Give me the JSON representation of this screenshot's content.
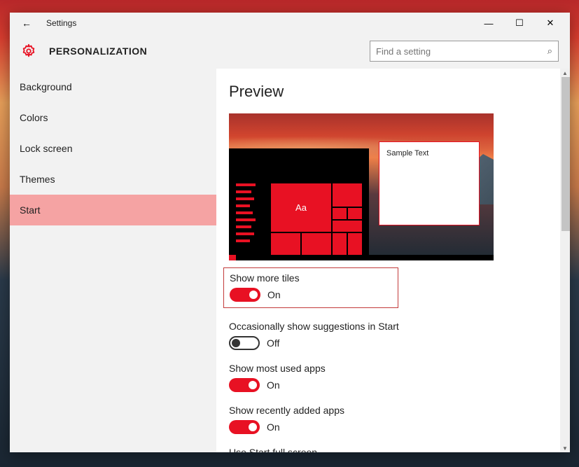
{
  "window": {
    "title": "Settings",
    "back_glyph": "←",
    "min_glyph": "—",
    "max_glyph": "☐",
    "close_glyph": "✕"
  },
  "header": {
    "page_title": "PERSONALIZATION",
    "search_placeholder": "Find a setting"
  },
  "sidebar": {
    "items": [
      {
        "label": "Background",
        "selected": false
      },
      {
        "label": "Colors",
        "selected": false
      },
      {
        "label": "Lock screen",
        "selected": false
      },
      {
        "label": "Themes",
        "selected": false
      },
      {
        "label": "Start",
        "selected": true
      }
    ]
  },
  "content": {
    "heading": "Preview",
    "preview": {
      "tile_text": "Aa",
      "sample_text": "Sample Text"
    },
    "settings": [
      {
        "label": "Show more tiles",
        "state": "On",
        "on": true,
        "highlighted": true
      },
      {
        "label": "Occasionally show suggestions in Start",
        "state": "Off",
        "on": false,
        "highlighted": false
      },
      {
        "label": "Show most used apps",
        "state": "On",
        "on": true,
        "highlighted": false
      },
      {
        "label": "Show recently added apps",
        "state": "On",
        "on": true,
        "highlighted": false
      },
      {
        "label": "Use Start full screen",
        "state": "",
        "on": null,
        "highlighted": false
      }
    ]
  },
  "colors": {
    "accent": "#e81123",
    "selected_bg": "#f5a3a3"
  }
}
